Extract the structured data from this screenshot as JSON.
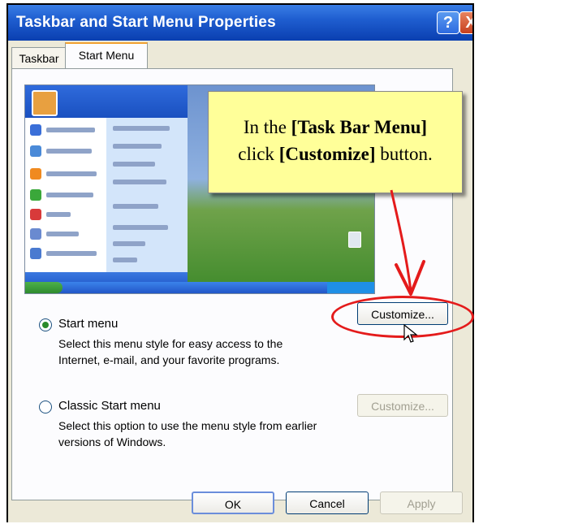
{
  "window": {
    "title": "Taskbar and Start Menu Properties",
    "help_glyph": "?",
    "close_glyph": "X"
  },
  "tabs": [
    {
      "label": "Taskbar"
    },
    {
      "label": "Start Menu",
      "selected": true
    }
  ],
  "callout": {
    "line1_prefix": "In the ",
    "line1_bold": "[Task Bar Menu]",
    "line2_bold": "[Customize]",
    "line2_suffix": " button.",
    "line2_prefix": "click "
  },
  "options": [
    {
      "label": "Start menu",
      "selected": true,
      "description": "Select this menu style for easy access to the Internet, e-mail, and your favorite programs.",
      "customize_label": "Customize...",
      "customize_enabled": true
    },
    {
      "label": "Classic Start menu",
      "selected": false,
      "description": "Select this option to use the menu style from earlier versions of Windows.",
      "customize_label": "Customize...",
      "customize_enabled": false
    }
  ],
  "footer": {
    "ok_label": "OK",
    "cancel_label": "Cancel",
    "apply_label": "Apply"
  },
  "colors": {
    "accent_red": "#e41b1b",
    "callout_bg": "#ffff99",
    "titlebar": "#1f5ed0"
  }
}
